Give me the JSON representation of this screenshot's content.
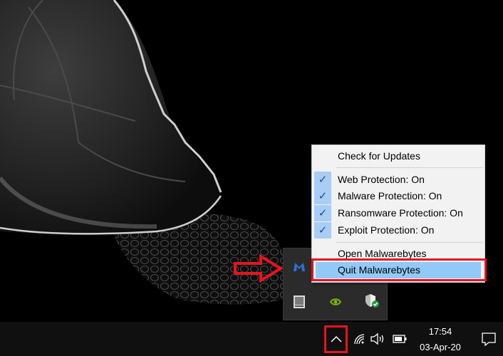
{
  "context_menu": {
    "check_updates": "Check for Updates",
    "items": [
      {
        "label": "Web Protection: On",
        "checked": true
      },
      {
        "label": "Malware Protection: On",
        "checked": true
      },
      {
        "label": "Ransomware Protection: On",
        "checked": true
      },
      {
        "label": "Exploit Protection: On",
        "checked": true
      }
    ],
    "open_app": "Open Malwarebytes",
    "quit_app": "Quit Malwarebytes",
    "check_glyph": "✓"
  },
  "tray_flyout": {
    "icons": [
      "malwarebytes-icon",
      "tablet-icon",
      "nvidia-icon",
      "windows-security-icon"
    ]
  },
  "taskbar": {
    "clock_time": "17:54",
    "clock_date": "03-Apr-20",
    "icons": [
      "show-hidden-icons-chevron-icon",
      "wifi-icon",
      "volume-icon",
      "battery-icon",
      "notifications-icon"
    ]
  },
  "annotation_colors": {
    "highlight_box": "#e8131f",
    "arrow": "#e8131f"
  }
}
